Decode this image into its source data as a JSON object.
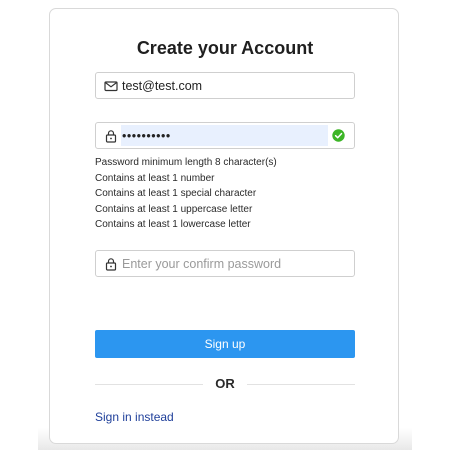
{
  "form": {
    "title": "Create your Account",
    "email": {
      "value": "test@test.com",
      "icon": "mail-icon"
    },
    "password": {
      "value": "••••••••••",
      "icon": "lock-icon",
      "status_icon": "check-circle-icon",
      "status_color": "#3cb526"
    },
    "password_rules": [
      "Password minimum length 8 character(s)",
      "Contains at least 1 number",
      "Contains at least 1 special character",
      "Contains at least 1 uppercase letter",
      "Contains at least 1 lowercase letter"
    ],
    "confirm_password": {
      "placeholder": "Enter your confirm password",
      "icon": "lock-icon"
    },
    "signup_label": "Sign up",
    "divider_label": "OR",
    "signin_label": "Sign in instead"
  },
  "colors": {
    "primary_button": "#2c96f0",
    "link": "#1f3f9a",
    "autofill_background": "#e8f0fe"
  }
}
